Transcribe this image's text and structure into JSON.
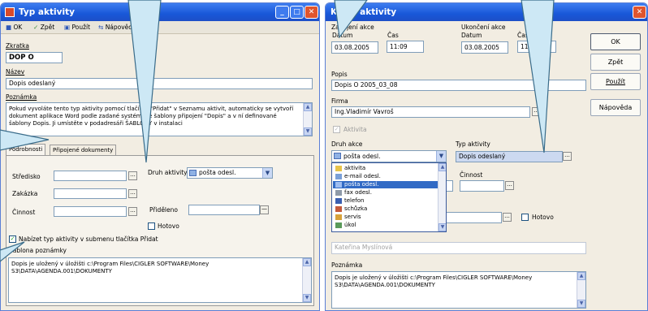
{
  "win1": {
    "title": "Typ aktivity",
    "toolbar": {
      "ok": "OK",
      "back": "Zpět",
      "apply": "Použít",
      "help": "Nápověda"
    },
    "labels": {
      "zkratka": "Zkratka",
      "nazev": "Název",
      "poznamka": "Poznámka"
    },
    "zkratka": "DOP O",
    "nazev": "Dopis odeslaný",
    "poznamka": "Pokud vyvoláte tento typ aktivity pomocí tlačítka \"Přidat\" v Seznamu aktivit, automaticky se vytvoří dokument aplikace Word podle zadané systémové šablony připojení \"Dopis\" a v ní definované šablony Dopis. Ji umístěte v podadresáři ŠABLONY v instalaci",
    "tabs": [
      "Podrobnosti",
      "Připojené dokumenty"
    ],
    "panel": {
      "strediskoLabel": "Středisko",
      "zakazkaLabel": "Zakázka",
      "cinnostLabel": "Činnost",
      "druhLabel": "Druh aktivity",
      "druhValue": "pošta odesl.",
      "pridelenoLabel": "Přiděleno",
      "hotovoLabel": "Hotovo",
      "nabizetLabel": "Nabízet typ aktivity v submenu tlačítka Přidat",
      "sablonaLabel": "Šablona poznámky",
      "sablonaText": "Dopis je uložený v úložišti c:\\Program Files\\CIGLER SOFTWARE\\Money S3\\DATA\\AGENDA.001\\DOKUMENTY"
    }
  },
  "win2": {
    "title": "Karta aktivity",
    "zahajeni": "Zahájení akce",
    "ukonceni": "Ukončení akce",
    "datumLabel": "Datum",
    "casLabel": "Čas",
    "startDate": "03.08.2005",
    "startTime": "11:09",
    "endDate": "03.08.2005",
    "endTime": "11:09",
    "buttons": {
      "ok": "OK",
      "back": "Zpět",
      "apply": "Použít",
      "help": "Nápověda"
    },
    "popisLabel": "Popis",
    "popis": "Dopis O 2005_03_08",
    "firmaLabel": "Firma",
    "firma": "Ing.Vladimír Vavroš",
    "aktivitaLabel": "Aktivita",
    "druhLabel": "Druh akce",
    "druhValue": "pošta odesl.",
    "typLabel": "Typ aktivity",
    "typValue": "Dopis odeslaný",
    "cinnostLabel": "Činnost",
    "hotovoLabel": "Hotovo",
    "person": "Kateřina Myslínová",
    "list": [
      "aktivita",
      "e-mail odesl.",
      "pošta odesl.",
      "fax odesl.",
      "telefon",
      "schůzka",
      "servis",
      "úkol"
    ],
    "poznamkaLabel": "Poznámka",
    "poznamka": "Dopis je uložený v úložišti c:\\Program Files\\CIGLER SOFTWARE\\Money S3\\DATA\\AGENDA.001\\DOKUMENTY"
  },
  "colors": {
    "titlebar": "#1857d8",
    "selection": "#316ac5"
  }
}
